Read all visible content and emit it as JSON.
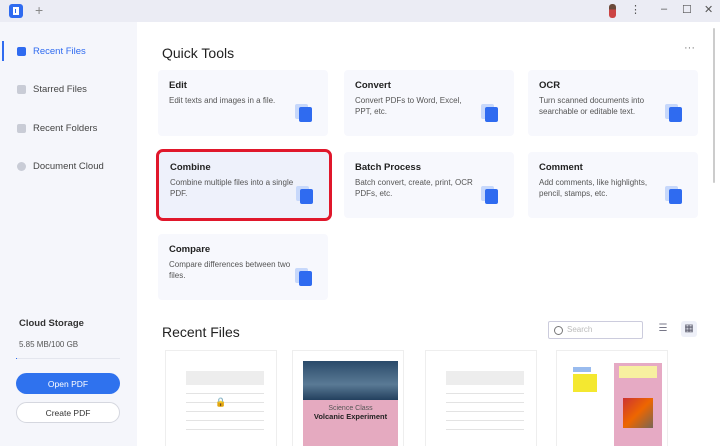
{
  "titlebar": {
    "new_tab": "+",
    "menu": "⋮",
    "minimize": "–",
    "maximize": "☐",
    "close": "✕"
  },
  "sidebar": {
    "items": [
      {
        "label": "Recent Files",
        "active": true
      },
      {
        "label": "Starred Files"
      },
      {
        "label": "Recent Folders"
      },
      {
        "label": "Document Cloud"
      }
    ],
    "cloud_storage": {
      "title": "Cloud Storage",
      "usage": "5.85 MB/100 GB",
      "used_fraction": 0.0001
    },
    "open_pdf": "Open PDF",
    "create_pdf": "Create PDF"
  },
  "quick_tools": {
    "title": "Quick Tools",
    "more": "···",
    "tools": [
      {
        "title": "Edit",
        "desc": "Edit texts and images in a file."
      },
      {
        "title": "Convert",
        "desc": "Convert PDFs to Word, Excel, PPT, etc."
      },
      {
        "title": "OCR",
        "desc": "Turn scanned documents into searchable or editable text."
      },
      {
        "title": "Combine",
        "desc": "Combine multiple files into a single PDF.",
        "highlighted": true
      },
      {
        "title": "Batch Process",
        "desc": "Batch convert, create, print, OCR PDFs, etc."
      },
      {
        "title": "Comment",
        "desc": "Add comments, like highlights, pencil, stamps, etc."
      },
      {
        "title": "Compare",
        "desc": "Compare differences between two files."
      }
    ]
  },
  "recent_files": {
    "title": "Recent Files",
    "search_placeholder": "Search",
    "list_view": "☰",
    "grid_view": "▦",
    "thumbs": [
      {
        "type": "locked"
      },
      {
        "type": "cover",
        "line1": "Science Class",
        "line2": "Volcanic Experiment"
      },
      {
        "type": "blank"
      },
      {
        "type": "poster"
      }
    ]
  },
  "colors": {
    "accent": "#2f6bf0",
    "highlight": "#e0172b"
  }
}
